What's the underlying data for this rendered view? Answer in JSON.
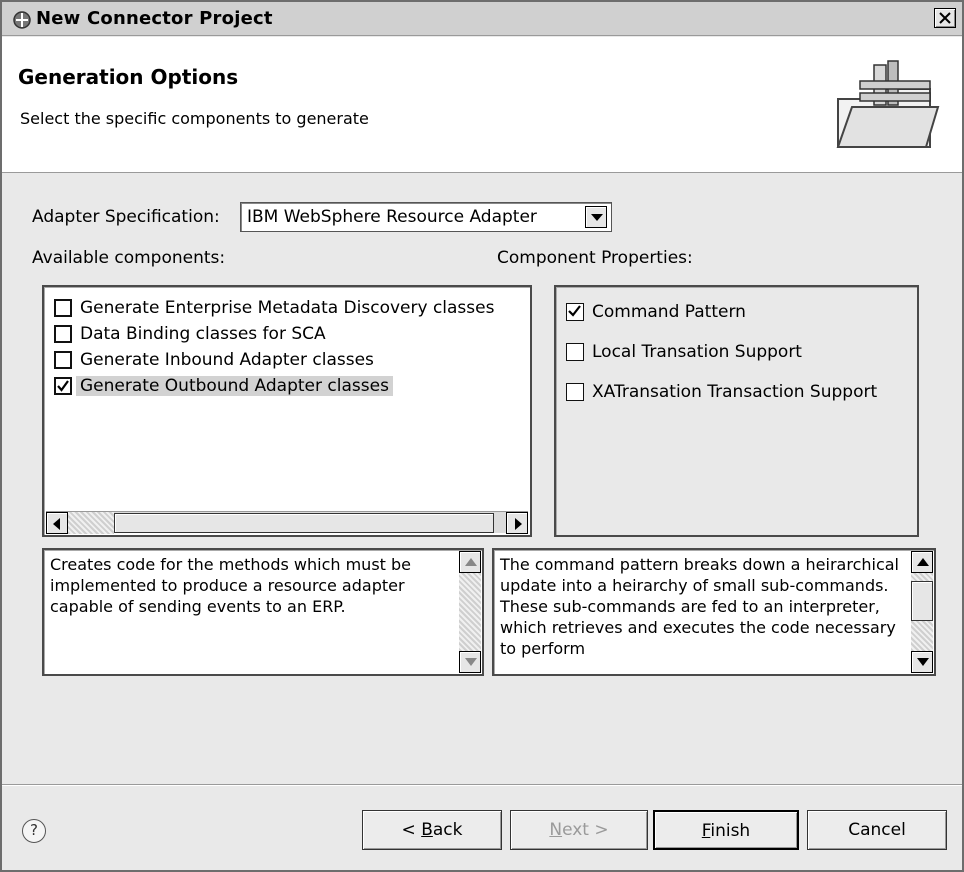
{
  "window": {
    "title": "New Connector Project",
    "close_label": "×"
  },
  "header": {
    "title": "Generation Options",
    "description": "Select the specific components to generate"
  },
  "adapter": {
    "label": "Adapter Specification:",
    "selected": "IBM WebSphere Resource Adapter"
  },
  "components": {
    "label": "Available components:",
    "items": [
      {
        "label": "Generate Enterprise Metadata Discovery classes",
        "checked": false
      },
      {
        "label": "Data Binding classes for SCA",
        "checked": false
      },
      {
        "label": "Generate Inbound Adapter classes",
        "checked": false
      },
      {
        "label": "Generate Outbound Adapter classes",
        "checked": true
      }
    ],
    "description": "Creates code for the methods which must be implemented to produce a resource adapter capable of sending events to an ERP."
  },
  "properties": {
    "label": "Component Properties:",
    "items": [
      {
        "label": "Command Pattern",
        "checked": true
      },
      {
        "label": "Local Transation Support",
        "checked": false
      },
      {
        "label": "XATransation Transaction Support",
        "checked": false
      }
    ],
    "description": "The command pattern breaks down a heirarchical update into a heirarchy of small sub-commands.  These sub-commands are fed to an interpreter, which retrieves and executes the code necessary to perform"
  },
  "buttons": {
    "help": "?",
    "back_prefix": "< ",
    "back_mnemonic": "B",
    "back_rest": "ack",
    "next_mnemonic": "N",
    "next_rest": "ext >",
    "finish_mnemonic": "F",
    "finish_rest": "inish",
    "cancel": "Cancel"
  }
}
